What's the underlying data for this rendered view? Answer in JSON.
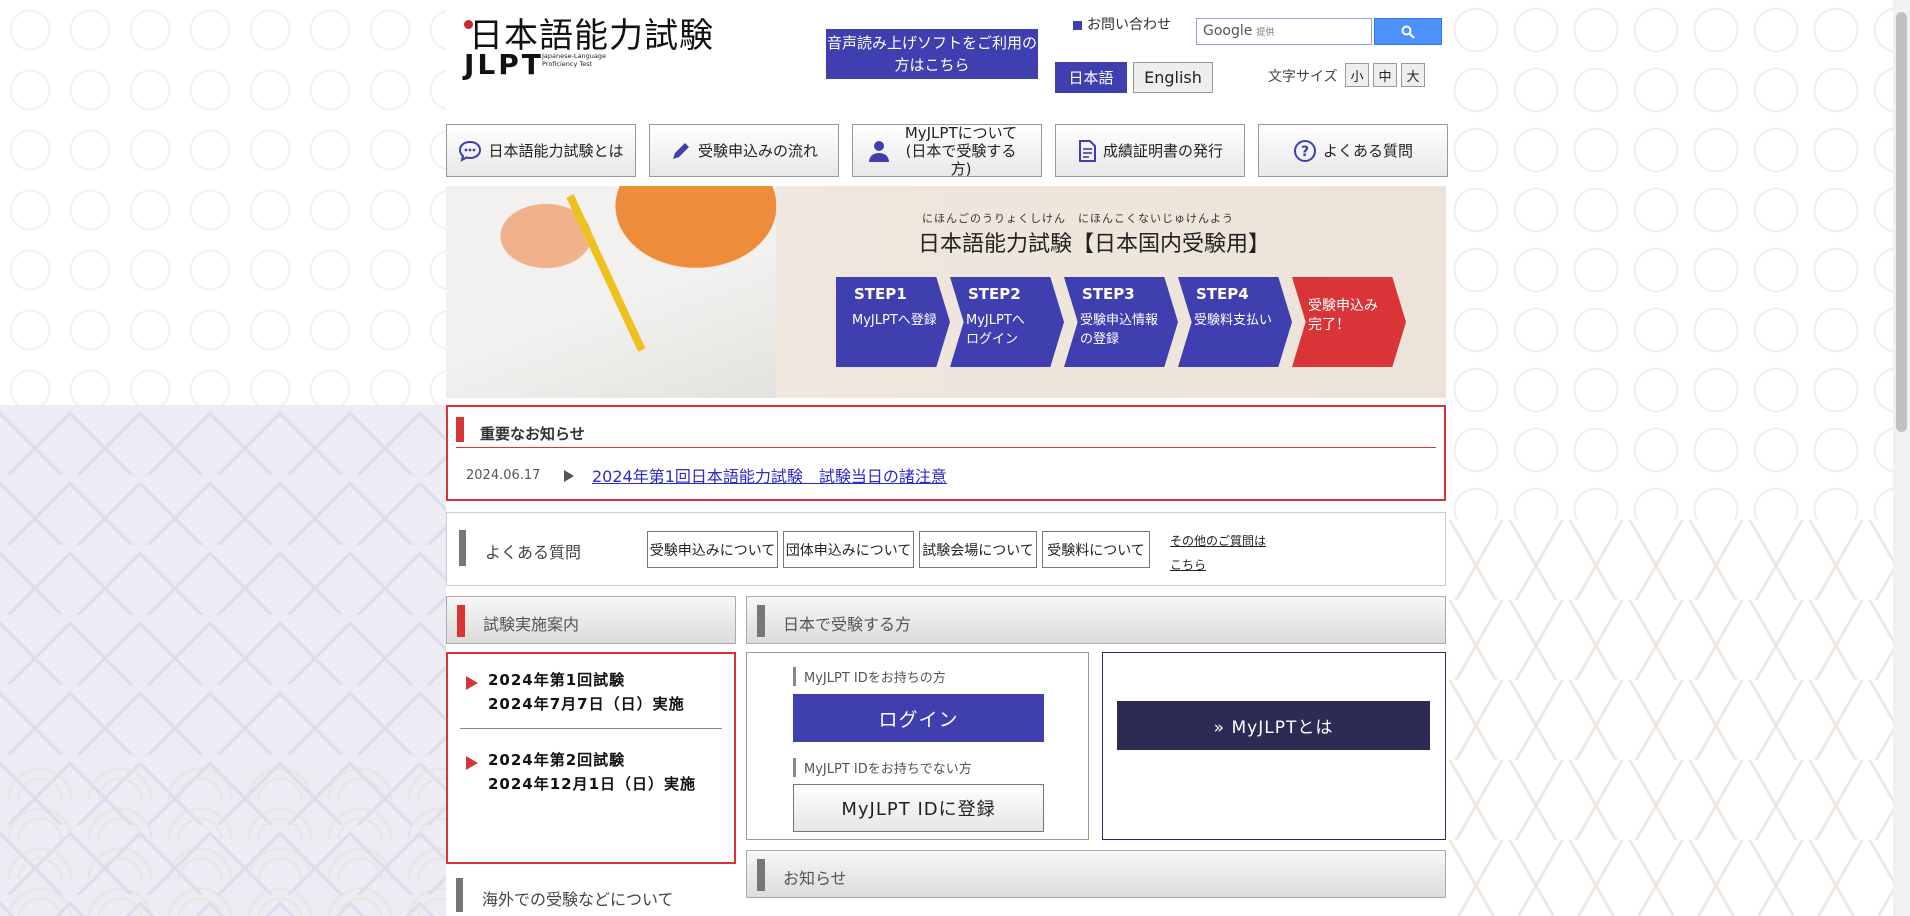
{
  "header": {
    "logo_title": "日本語能力試験",
    "logo_jlpt": "JLPT",
    "logo_sub": "Japanese-Language Proficiency Test",
    "voice_button": "音声読み上げソフトをご利用の方はこちら",
    "contact": "お問い合わせ",
    "search_placeholder": "Google",
    "search_provided": "提供",
    "lang_ja": "日本語",
    "lang_en": "English",
    "font_size_label": "文字サイズ",
    "font_small": "小",
    "font_medium": "中",
    "font_large": "大"
  },
  "nav": [
    {
      "label": "日本語能力試験とは"
    },
    {
      "label": "受験申込みの流れ"
    },
    {
      "label": "MyJLPTについて(日本で受験する方)"
    },
    {
      "label": "成績証明書の発行"
    },
    {
      "label": "よくある質問"
    }
  ],
  "hero": {
    "ruby": "にほんごのうりょくしけん　にほんこくないじゅけんよう",
    "title": "日本語能力試験【日本国内受験用】",
    "steps": [
      {
        "num": "STEP1",
        "text": "MyJLPTへ登録"
      },
      {
        "num": "STEP2",
        "text": "MyJLPTへログイン"
      },
      {
        "num": "STEP3",
        "text": "受験申込情報の登録"
      },
      {
        "num": "STEP4",
        "text": "受験料支払い"
      },
      {
        "num": "",
        "text": "受験申込み完了！"
      }
    ]
  },
  "notice": {
    "title": "重要なお知らせ",
    "date": "2024.06.17",
    "link": "2024年第1回日本語能力試験　試験当日の諸注意"
  },
  "faq": {
    "title": "よくある質問",
    "buttons": [
      "受験申込みについて",
      "団体申込みについて",
      "試験会場について",
      "受験料について"
    ],
    "other_line1": "その他のご質問は",
    "other_line2": "こちら"
  },
  "schedule": {
    "header": "試験実施案内",
    "items": [
      {
        "line1": "2024年第1回試験",
        "line2": "2024年7月7日（日）実施"
      },
      {
        "line1": "2024年第2回試験",
        "line2": "2024年12月1日（日）実施"
      }
    ]
  },
  "japan": {
    "header": "日本で受験する方",
    "has_id_label": "MyJLPT IDをお持ちの方",
    "login": "ログイン",
    "no_id_label": "MyJLPT IDをお持ちでない方",
    "register": "MyJLPT IDに登録",
    "about": "» MyJLPTとは"
  },
  "news_header": "お知らせ",
  "overseas": "海外での受験などについて",
  "colors": {
    "accent_blue": "#3f3fb0",
    "accent_red": "#d93438",
    "dark_navy": "#2d2b55"
  }
}
